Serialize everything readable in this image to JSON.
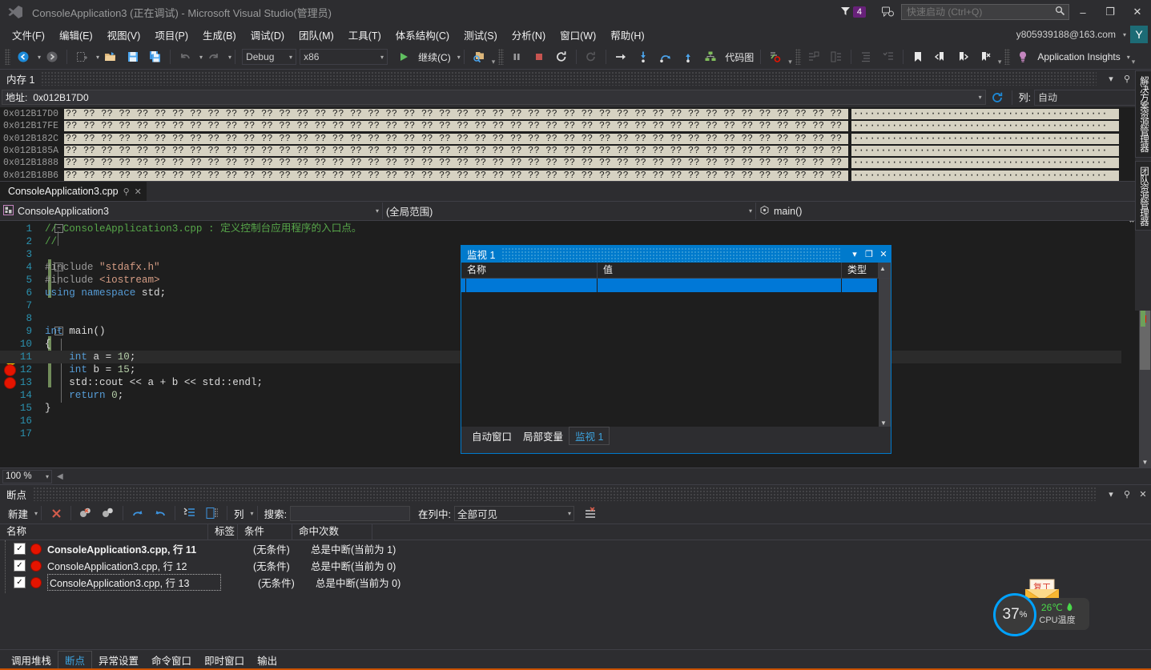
{
  "titlebar": {
    "app_title": "ConsoleApplication3 (正在调试) - Microsoft Visual Studio(管理员)",
    "logo_icon": "visual-studio-logo-icon",
    "notification_icon": "funnel-icon",
    "notification_count": "4",
    "feedback_icon": "feedback-smiley-icon",
    "quick_launch_placeholder": "快速启动 (Ctrl+Q)",
    "quick_launch_value": "",
    "search_icon": "search-icon",
    "minimize": "–",
    "maximize": "❐",
    "close": "✕"
  },
  "menubar": {
    "items": [
      {
        "label": "文件(F)"
      },
      {
        "label": "编辑(E)"
      },
      {
        "label": "视图(V)"
      },
      {
        "label": "项目(P)"
      },
      {
        "label": "生成(B)"
      },
      {
        "label": "调试(D)"
      },
      {
        "label": "团队(M)"
      },
      {
        "label": "工具(T)"
      },
      {
        "label": "体系结构(C)"
      },
      {
        "label": "测试(S)"
      },
      {
        "label": "分析(N)"
      },
      {
        "label": "窗口(W)"
      },
      {
        "label": "帮助(H)"
      }
    ],
    "account_email": "y805939188@163.com",
    "account_initial": "Y"
  },
  "toolbar": {
    "nav_back_icon": "navigate-back-icon",
    "nav_forward_icon": "navigate-forward-icon",
    "new_project_icon": "new-project-icon",
    "open_file_icon": "open-file-icon",
    "save_icon": "save-icon",
    "save_all_icon": "save-all-icon",
    "undo_icon": "undo-icon",
    "redo_icon": "redo-icon",
    "config_value": "Debug",
    "platform_value": "x86",
    "continue_label": "继续(C)",
    "continue_icon": "play-icon",
    "attach_icon": "attach-to-process-icon",
    "pause_icon": "pause-icon",
    "stop_icon": "stop-icon",
    "restart_icon": "restart-icon",
    "restart_alt_icon": "restart-disabled-icon",
    "show_next_statement_icon": "show-next-statement-icon",
    "step_into_icon": "step-into-icon",
    "step_over_icon": "step-over-icon",
    "step_out_icon": "step-out-icon",
    "code_map_icon": "code-map-icon",
    "code_map_label": "代码图",
    "breakpoint_toggle_icon": "toggle-breakpoint-icon",
    "indent_icon": "indent-icon",
    "outdent_icon": "outdent-icon",
    "comment_icon": "comment-selection-icon",
    "uncomment_icon": "uncomment-selection-icon",
    "bookmark_icon": "bookmark-icon",
    "prev_bookmark_icon": "previous-bookmark-icon",
    "next_bookmark_icon": "next-bookmark-icon",
    "clear_bookmarks_icon": "clear-bookmarks-icon",
    "app_insights_icon": "lightbulb-icon",
    "app_insights_label": "Application Insights"
  },
  "memory_window": {
    "title": "内存 1",
    "dropdown_icon": "chevron-down-icon",
    "pin_icon": "pin-icon",
    "close_icon": "close-icon",
    "address_label": "地址:",
    "address_value": "0x012B17D0",
    "address_dropdown_icon": "chevron-down-icon",
    "refresh_icon": "refresh-icon",
    "columns_label": "列:",
    "columns_value": "自动",
    "rows": [
      {
        "address": "0x012B17D0",
        "hex": "?? ?? ?? ?? ?? ?? ?? ?? ?? ?? ?? ?? ?? ?? ?? ?? ?? ?? ?? ?? ?? ?? ?? ?? ?? ?? ?? ?? ?? ?? ?? ?? ?? ?? ?? ?? ?? ?? ?? ?? ?? ?? ?? ?? ?? ??",
        "ascii": "··············································"
      },
      {
        "address": "0x012B17FE",
        "hex": "?? ?? ?? ?? ?? ?? ?? ?? ?? ?? ?? ?? ?? ?? ?? ?? ?? ?? ?? ?? ?? ?? ?? ?? ?? ?? ?? ?? ?? ?? ?? ?? ?? ?? ?? ?? ?? ?? ?? ?? ?? ?? ?? ?? ?? ??",
        "ascii": "··············································"
      },
      {
        "address": "0x012B182C",
        "hex": "?? ?? ?? ?? ?? ?? ?? ?? ?? ?? ?? ?? ?? ?? ?? ?? ?? ?? ?? ?? ?? ?? ?? ?? ?? ?? ?? ?? ?? ?? ?? ?? ?? ?? ?? ?? ?? ?? ?? ?? ?? ?? ?? ?? ?? ??",
        "ascii": "··············································"
      },
      {
        "address": "0x012B185A",
        "hex": "?? ?? ?? ?? ?? ?? ?? ?? ?? ?? ?? ?? ?? ?? ?? ?? ?? ?? ?? ?? ?? ?? ?? ?? ?? ?? ?? ?? ?? ?? ?? ?? ?? ?? ?? ?? ?? ?? ?? ?? ?? ?? ?? ?? ?? ??",
        "ascii": "··············································"
      },
      {
        "address": "0x012B1888",
        "hex": "?? ?? ?? ?? ?? ?? ?? ?? ?? ?? ?? ?? ?? ?? ?? ?? ?? ?? ?? ?? ?? ?? ?? ?? ?? ?? ?? ?? ?? ?? ?? ?? ?? ?? ?? ?? ?? ?? ?? ?? ?? ?? ?? ?? ?? ??",
        "ascii": "··············································"
      },
      {
        "address": "0x012B18B6",
        "hex": "?? ?? ?? ?? ?? ?? ?? ?? ?? ?? ?? ?? ?? ?? ?? ?? ?? ?? ?? ?? ?? ?? ?? ?? ?? ?? ?? ?? ?? ?? ?? ?? ?? ?? ?? ?? ?? ?? ?? ?? ?? ?? ?? ?? ?? ??",
        "ascii": "··············································"
      }
    ]
  },
  "editor": {
    "tab_label": "ConsoleApplication3.cpp",
    "tab_pin_icon": "pin-icon",
    "tab_close_icon": "close-icon",
    "nav_project": "ConsoleApplication3",
    "nav_project_icon": "cpp-project-icon",
    "nav_scope": "(全局范围)",
    "nav_member": "main()",
    "nav_member_icon": "method-icon",
    "zoom_level": "100 %",
    "lines": [
      {
        "n": "1",
        "text": "// ConsoleApplication3.cpp : 定义控制台应用程序的入口点。",
        "style": "cmt"
      },
      {
        "n": "2",
        "text": "//",
        "style": "cmt"
      },
      {
        "n": "3",
        "text": "",
        "style": "plain"
      },
      {
        "n": "4",
        "text": "#include \"stdafx.h\"",
        "style": "pp"
      },
      {
        "n": "5",
        "text": "#include <iostream>",
        "style": "pp"
      },
      {
        "n": "6",
        "text": "using namespace std;",
        "style": "kw"
      },
      {
        "n": "7",
        "text": "",
        "style": "plain"
      },
      {
        "n": "8",
        "text": "",
        "style": "plain"
      },
      {
        "n": "9",
        "text": "int main()",
        "style": "code"
      },
      {
        "n": "10",
        "text": "{",
        "style": "code"
      },
      {
        "n": "11",
        "text": "    int a = 10;",
        "style": "code"
      },
      {
        "n": "12",
        "text": "    int b = 15;",
        "style": "code"
      },
      {
        "n": "13",
        "text": "    std::cout << a + b << std::endl;",
        "style": "code"
      },
      {
        "n": "14",
        "text": "    return 0;",
        "style": "code"
      },
      {
        "n": "15",
        "text": "}",
        "style": "code"
      },
      {
        "n": "16",
        "text": "",
        "style": "plain"
      },
      {
        "n": "17",
        "text": "",
        "style": "plain"
      }
    ]
  },
  "watch_window": {
    "title": "监视 1",
    "dropdown_icon": "chevron-down-icon",
    "maximize_icon": "maximize-icon",
    "close_icon": "close-icon",
    "columns": [
      "名称",
      "值",
      "类型"
    ],
    "rows": [
      {
        "name": "",
        "value": "",
        "type": ""
      }
    ],
    "tabs": [
      {
        "label": "自动窗口",
        "active": false
      },
      {
        "label": "局部变量",
        "active": false
      },
      {
        "label": "监视 1",
        "active": true
      }
    ]
  },
  "breakpoints_pane": {
    "title": "断点",
    "dropdown_icon": "chevron-down-icon",
    "pin_icon": "pin-icon",
    "close_icon": "close-icon",
    "new_label": "新建",
    "delete_icon": "delete-breakpoint-icon",
    "delete_all_icon": "delete-all-breakpoints-icon",
    "disable_all_icon": "disable-all-breakpoints-icon",
    "export_icon": "export-breakpoints-icon",
    "import_icon": "import-breakpoints-icon",
    "goto_source_icon": "go-to-source-icon",
    "goto_disasm_icon": "go-to-disassembly-icon",
    "columns_label": "列",
    "search_label": "搜索:",
    "search_value": "",
    "in_columns_label": "在列中:",
    "in_columns_value": "全部可见",
    "match_case_icon": "match-criteria-icon",
    "headers": [
      "名称",
      "标签",
      "条件",
      "命中次数"
    ],
    "rows": [
      {
        "checked": true,
        "name": "ConsoleApplication3.cpp, 行 11",
        "label": "",
        "condition": "(无条件)",
        "hit_count": "总是中断(当前为 1)",
        "bold": true,
        "focused": false
      },
      {
        "checked": true,
        "name": "ConsoleApplication3.cpp, 行 12",
        "label": "",
        "condition": "(无条件)",
        "hit_count": "总是中断(当前为 0)",
        "bold": false,
        "focused": false
      },
      {
        "checked": true,
        "name": "ConsoleApplication3.cpp, 行 13",
        "label": "",
        "condition": "(无条件)",
        "hit_count": "总是中断(当前为 0)",
        "bold": false,
        "focused": true
      }
    ]
  },
  "bottom_tabs": [
    {
      "label": "调用堆栈",
      "active": false
    },
    {
      "label": "断点",
      "active": true
    },
    {
      "label": "异常设置",
      "active": false
    },
    {
      "label": "命令窗口",
      "active": false
    },
    {
      "label": "即时窗口",
      "active": false
    },
    {
      "label": "输出",
      "active": false
    }
  ],
  "right_dock": [
    {
      "label": "解决方案资源管理器"
    },
    {
      "label": "团队资源管理器"
    }
  ],
  "cpu_widget": {
    "percent": "37",
    "percent_symbol": "%",
    "temperature": "26℃",
    "temp_icon": "leaf-icon",
    "label": "CPU温度",
    "envelope_text": "复工",
    "ring_color": "#00a2ff"
  },
  "colors": {
    "accent": "#007acc",
    "chrome": "#2d2d30",
    "editor_bg": "#1e1e1e",
    "breakpoint_red": "#e51400",
    "status_orange": "#ca5100",
    "badge_purple": "#68217a"
  }
}
